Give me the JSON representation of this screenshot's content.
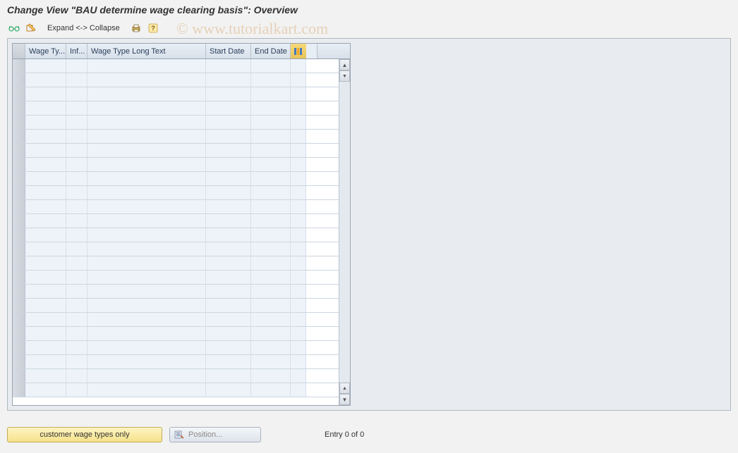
{
  "title": "Change View \"BAU determine wage clearing basis\": Overview",
  "toolbar": {
    "expand_label": "Expand <-> Collapse"
  },
  "grid": {
    "columns": {
      "wage_type": "Wage Ty...",
      "inf": "Inf...",
      "long_text": "Wage Type Long Text",
      "start_date": "Start Date",
      "end_date": "End Date"
    },
    "row_count": 24
  },
  "footer": {
    "customer_btn": "customer wage types only",
    "position_btn": "Position...",
    "entry_text": "Entry 0 of 0"
  },
  "watermark": "© www.tutorialkart.com"
}
